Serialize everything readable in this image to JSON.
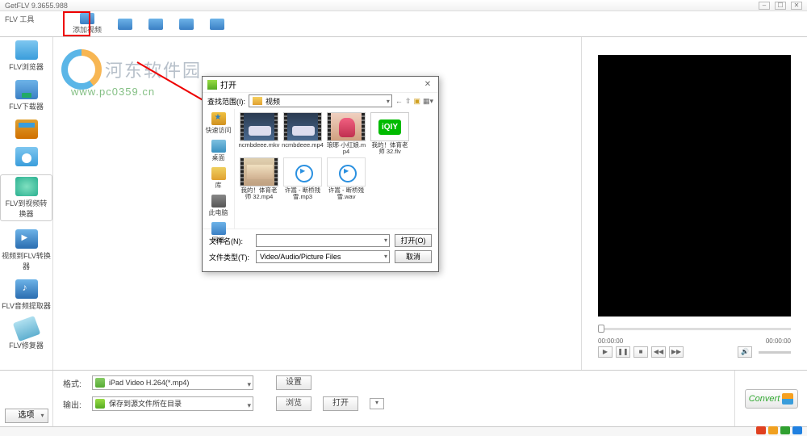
{
  "title": "GetFLV 9.3655.988",
  "tool_row_label": "FLV 工具",
  "toolbar": [
    {
      "label": "添加视频"
    },
    {
      "label": ""
    },
    {
      "label": ""
    },
    {
      "label": ""
    },
    {
      "label": ""
    }
  ],
  "sidebar": [
    {
      "label": "FLV浏览器"
    },
    {
      "label": "FLV下载器"
    },
    {
      "label": ""
    },
    {
      "label": ""
    },
    {
      "label": "FLV到视频转换器"
    },
    {
      "label": "视频到FLV转换器"
    },
    {
      "label": "FLV音频提取器"
    },
    {
      "label": "FLV修复器"
    }
  ],
  "watermark_text": "河东软件园",
  "watermark_url": "www.pc0359.cn",
  "center_watermark": "",
  "preview": {
    "time_start": "00:00:00",
    "time_end": "00:00:00"
  },
  "bottom": {
    "row1_label": "格式:",
    "row1_value": "iPad Video H.264(*.mp4)",
    "row1_btn": "设置",
    "row2_label": "输出:",
    "row2_value": "保存到源文件所在目录",
    "row2_btn1": "浏览",
    "row2_btn2": "打开",
    "options_btn": "选项",
    "convert": "Convert"
  },
  "dialog": {
    "title": "打开",
    "lookin_label": "查找范围(I):",
    "lookin_value": "视频",
    "places": [
      {
        "label": "快速访问"
      },
      {
        "label": "桌面"
      },
      {
        "label": "库"
      },
      {
        "label": "此电脑"
      },
      {
        "label": "网络"
      }
    ],
    "files": [
      {
        "name": "ncmbdeee.mkv",
        "kind": "car"
      },
      {
        "name": "ncmbdeee.mp4",
        "kind": "car"
      },
      {
        "name": "琅琊·小红娘.mp4",
        "kind": "girl"
      },
      {
        "name": "我的！体育老师 32.flv",
        "kind": "iqiyi"
      },
      {
        "name": "我的！体育老师 32.mp4",
        "kind": "teacher"
      },
      {
        "name": "许嵩 - 断桥残雪.mp3",
        "kind": "audio"
      },
      {
        "name": "许嵩 - 断桥残雪.wav",
        "kind": "audio"
      }
    ],
    "filename_label": "文件名(N):",
    "filename_value": "",
    "filetype_label": "文件类型(T):",
    "filetype_value": "Video/Audio/Picture Files",
    "open_btn": "打开(O)",
    "cancel_btn": "取消"
  }
}
